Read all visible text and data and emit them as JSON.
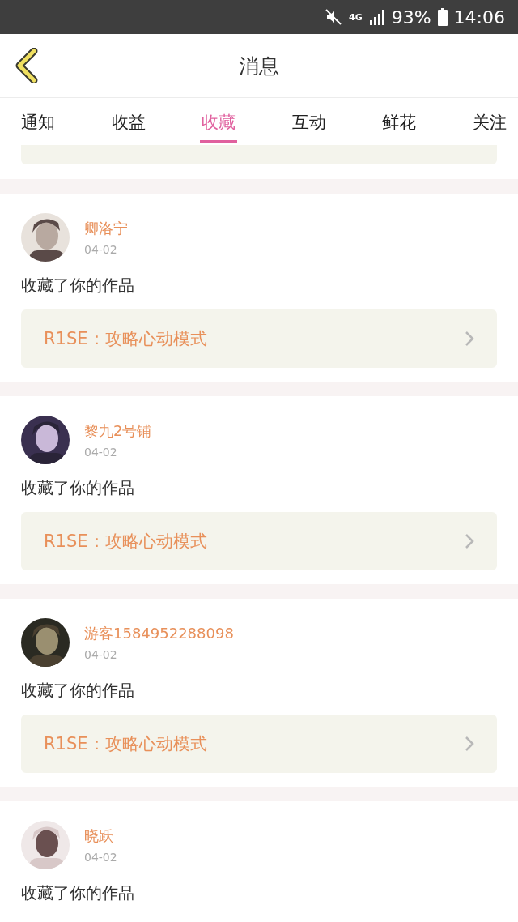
{
  "status_bar": {
    "network": "4G",
    "battery": "93%",
    "time": "14:06"
  },
  "header": {
    "title": "消息"
  },
  "tabs": [
    {
      "label": "通知",
      "selected": false
    },
    {
      "label": "收益",
      "selected": false
    },
    {
      "label": "收藏",
      "selected": true
    },
    {
      "label": "互动",
      "selected": false
    },
    {
      "label": "鲜花",
      "selected": false
    },
    {
      "label": "关注",
      "selected": false
    }
  ],
  "messages": [
    {
      "user": "卿洛宁",
      "date": "04-02",
      "text": "收藏了你的作品",
      "work": "R1SE：攻略心动模式"
    },
    {
      "user": "黎九2号铺",
      "date": "04-02",
      "text": "收藏了你的作品",
      "work": "R1SE：攻略心动模式"
    },
    {
      "user": "游客1584952288098",
      "date": "04-02",
      "text": "收藏了你的作品",
      "work": "R1SE：攻略心动模式"
    },
    {
      "user": "晓跃",
      "date": "04-02",
      "text": "收藏了你的作品"
    }
  ]
}
